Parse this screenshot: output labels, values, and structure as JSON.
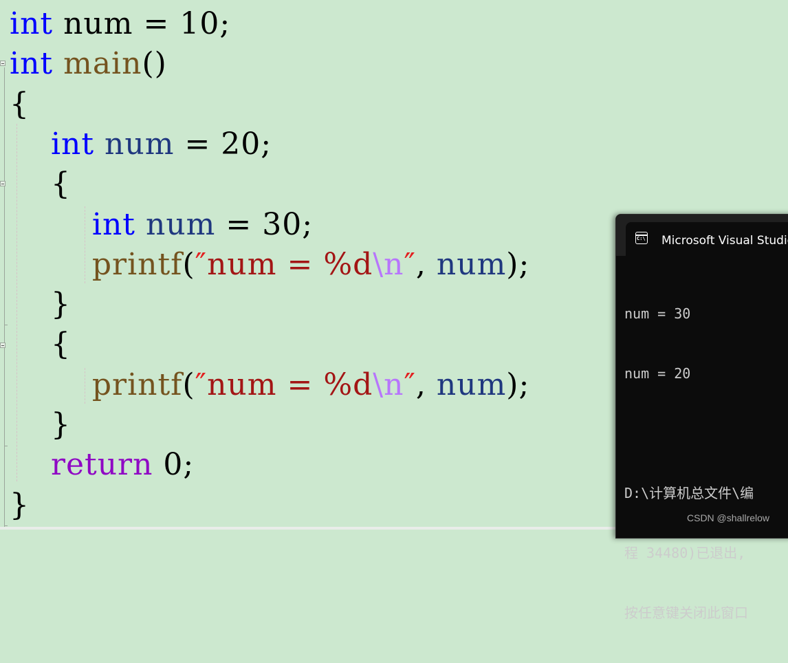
{
  "editor": {
    "lines": [
      {
        "tokens": [
          {
            "t": "int",
            "c": "kw"
          },
          {
            "t": " ",
            "c": "plain"
          },
          {
            "t": "num",
            "c": "plain"
          },
          {
            "t": " = 10;",
            "c": "plain"
          }
        ]
      },
      {
        "tokens": [
          {
            "t": "int",
            "c": "kw"
          },
          {
            "t": " ",
            "c": "plain"
          },
          {
            "t": "main",
            "c": "fn"
          },
          {
            "t": "()",
            "c": "plain"
          }
        ]
      },
      {
        "tokens": [
          {
            "t": "{",
            "c": "plain"
          }
        ]
      },
      {
        "tokens": [
          {
            "t": "    ",
            "c": "plain"
          },
          {
            "t": "int",
            "c": "kw"
          },
          {
            "t": " ",
            "c": "plain"
          },
          {
            "t": "num",
            "c": "id"
          },
          {
            "t": " = 20;",
            "c": "plain"
          }
        ]
      },
      {
        "tokens": [
          {
            "t": "    {",
            "c": "plain"
          }
        ]
      },
      {
        "tokens": [
          {
            "t": "        ",
            "c": "plain"
          },
          {
            "t": "int",
            "c": "kw"
          },
          {
            "t": " ",
            "c": "plain"
          },
          {
            "t": "num",
            "c": "id"
          },
          {
            "t": " = 30;",
            "c": "plain"
          }
        ]
      },
      {
        "tokens": [
          {
            "t": "        ",
            "c": "plain"
          },
          {
            "t": "printf",
            "c": "fn"
          },
          {
            "t": "(",
            "c": "plain"
          },
          {
            "t": "″",
            "c": "q"
          },
          {
            "t": "num = %d",
            "c": "str"
          },
          {
            "t": "\\n",
            "c": "esc"
          },
          {
            "t": "″",
            "c": "q"
          },
          {
            "t": ", ",
            "c": "plain"
          },
          {
            "t": "num",
            "c": "id"
          },
          {
            "t": ");",
            "c": "plain"
          }
        ]
      },
      {
        "tokens": [
          {
            "t": "    }",
            "c": "plain"
          }
        ]
      },
      {
        "tokens": [
          {
            "t": "    {",
            "c": "plain"
          }
        ]
      },
      {
        "tokens": [
          {
            "t": "        ",
            "c": "plain"
          },
          {
            "t": "printf",
            "c": "fn"
          },
          {
            "t": "(",
            "c": "plain"
          },
          {
            "t": "″",
            "c": "q"
          },
          {
            "t": "num = %d",
            "c": "str"
          },
          {
            "t": "\\n",
            "c": "esc"
          },
          {
            "t": "″",
            "c": "q"
          },
          {
            "t": ", ",
            "c": "plain"
          },
          {
            "t": "num",
            "c": "id"
          },
          {
            "t": ");",
            "c": "plain"
          }
        ]
      },
      {
        "tokens": [
          {
            "t": "    }",
            "c": "plain"
          }
        ]
      },
      {
        "tokens": [
          {
            "t": "    ",
            "c": "plain"
          },
          {
            "t": "return",
            "c": "ret"
          },
          {
            "t": " 0;",
            "c": "plain"
          }
        ]
      },
      {
        "tokens": [
          {
            "t": "}",
            "c": "plain"
          }
        ]
      }
    ]
  },
  "console": {
    "icon": "terminal-icon",
    "icon_text": "C:\\",
    "title": "Microsoft Visual Studio 调试控制台",
    "output": [
      "num = 30",
      "num = 20",
      "",
      "D:\\计算机总文件\\编",
      "程 34480)已退出,",
      "按任意键关闭此窗口"
    ]
  },
  "watermark": "CSDN @shallrelow",
  "colors": {
    "editor_background": "#cce8cf",
    "keyword": "#0000ff",
    "function": "#74531f",
    "identifier": "#1f377f",
    "string": "#a31515",
    "escape": "#b776fb",
    "return_keyword": "#8f08c4",
    "console_background": "#0c0c0c",
    "console_text": "#cccccc"
  }
}
